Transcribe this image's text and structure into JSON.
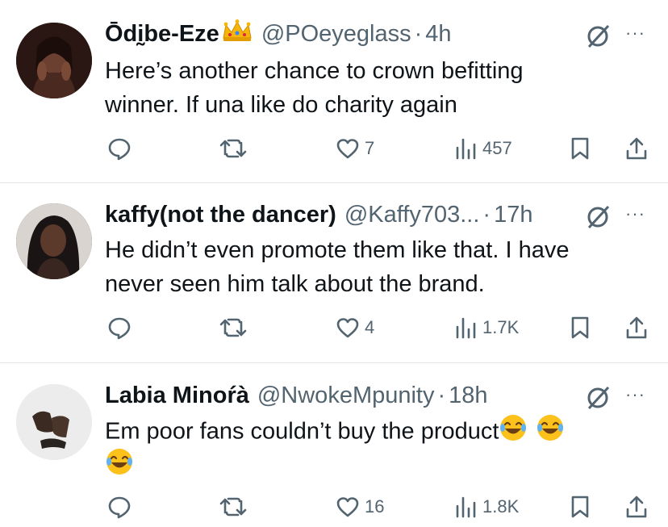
{
  "tweets": [
    {
      "name": "Ōdḭbe-Eze",
      "name_emoji": "crown-emoji",
      "handle": "@POeyeglass",
      "dot": "·",
      "time": "4h",
      "line1": "Here’s another chance to crown befitting",
      "line2": "winner. If una like do charity again",
      "likes": "7",
      "views": "457",
      "avatar_bg": "#3a1f1a"
    },
    {
      "name": "kaffy(not the dancer)",
      "handle": "@Kaffy703...",
      "dot": "·",
      "time": "17h",
      "line1": "He didn’t even promote them like that. I have",
      "line2": "never seen him talk about the brand.",
      "likes": "4",
      "views": "1.7K",
      "avatar_bg": "#2c2c2c"
    },
    {
      "name": "Labia Minoŕà",
      "handle": "@NwokeMpunity",
      "dot": "·",
      "time": "18h",
      "line1": "Em poor fans couldn’t buy the product",
      "line2": "",
      "likes": "16",
      "views": "1.8K",
      "avatar_bg": "#e9e9e9"
    }
  ],
  "more_label": "···",
  "colors": {
    "text": "#0f1419",
    "secondary": "#536471",
    "divider": "#e6e6e6"
  }
}
